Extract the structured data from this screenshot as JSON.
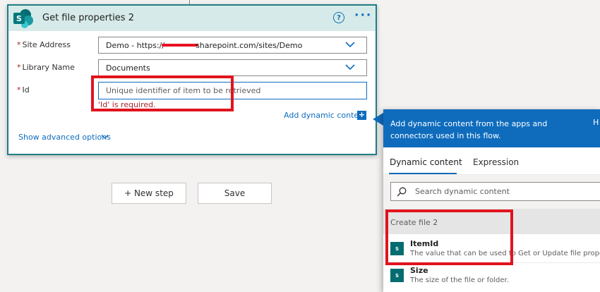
{
  "card": {
    "title": "Get file properties 2",
    "help_glyph": "?",
    "more_glyph": "···",
    "icon": "sharepoint-logo-icon"
  },
  "fields": {
    "site_address": {
      "label": "Site Address",
      "value_prefix": "Demo - https://",
      "value_suffix": "sharepoint.com/sites/Demo"
    },
    "library_name": {
      "label": "Library Name",
      "value": "Documents"
    },
    "id": {
      "label": "Id",
      "placeholder": "Unique identifier of item to be retrieved",
      "error": "'Id' is required."
    },
    "required_marker": "*"
  },
  "links": {
    "add_dynamic_content": "Add dynamic content",
    "add_dynamic_content_glyph": "+",
    "show_advanced_options": "Show advanced options"
  },
  "steps": {
    "new_step": "+ New step",
    "save": "Save"
  },
  "panel": {
    "header_text": "Add dynamic content from the apps and connectors used in this flow.",
    "header_extra": "H",
    "tabs": [
      {
        "label": "Dynamic content",
        "active": true
      },
      {
        "label": "Expression",
        "active": false
      }
    ],
    "search_placeholder": "Search dynamic content",
    "section_title": "Create file 2",
    "item_icon_text": "S",
    "items": [
      {
        "name": "ItemId",
        "description": "The value that can be used to Get or Update file properti..."
      },
      {
        "name": "Size",
        "description": "The size of the file or folder."
      }
    ]
  },
  "colors": {
    "accent": "#0f6cbd",
    "card_header": "#d6ebe9",
    "card_border": "#217d86",
    "error": "#a4262c",
    "highlight_box": "#e0141e",
    "sharepoint_teal": "#036c70"
  }
}
